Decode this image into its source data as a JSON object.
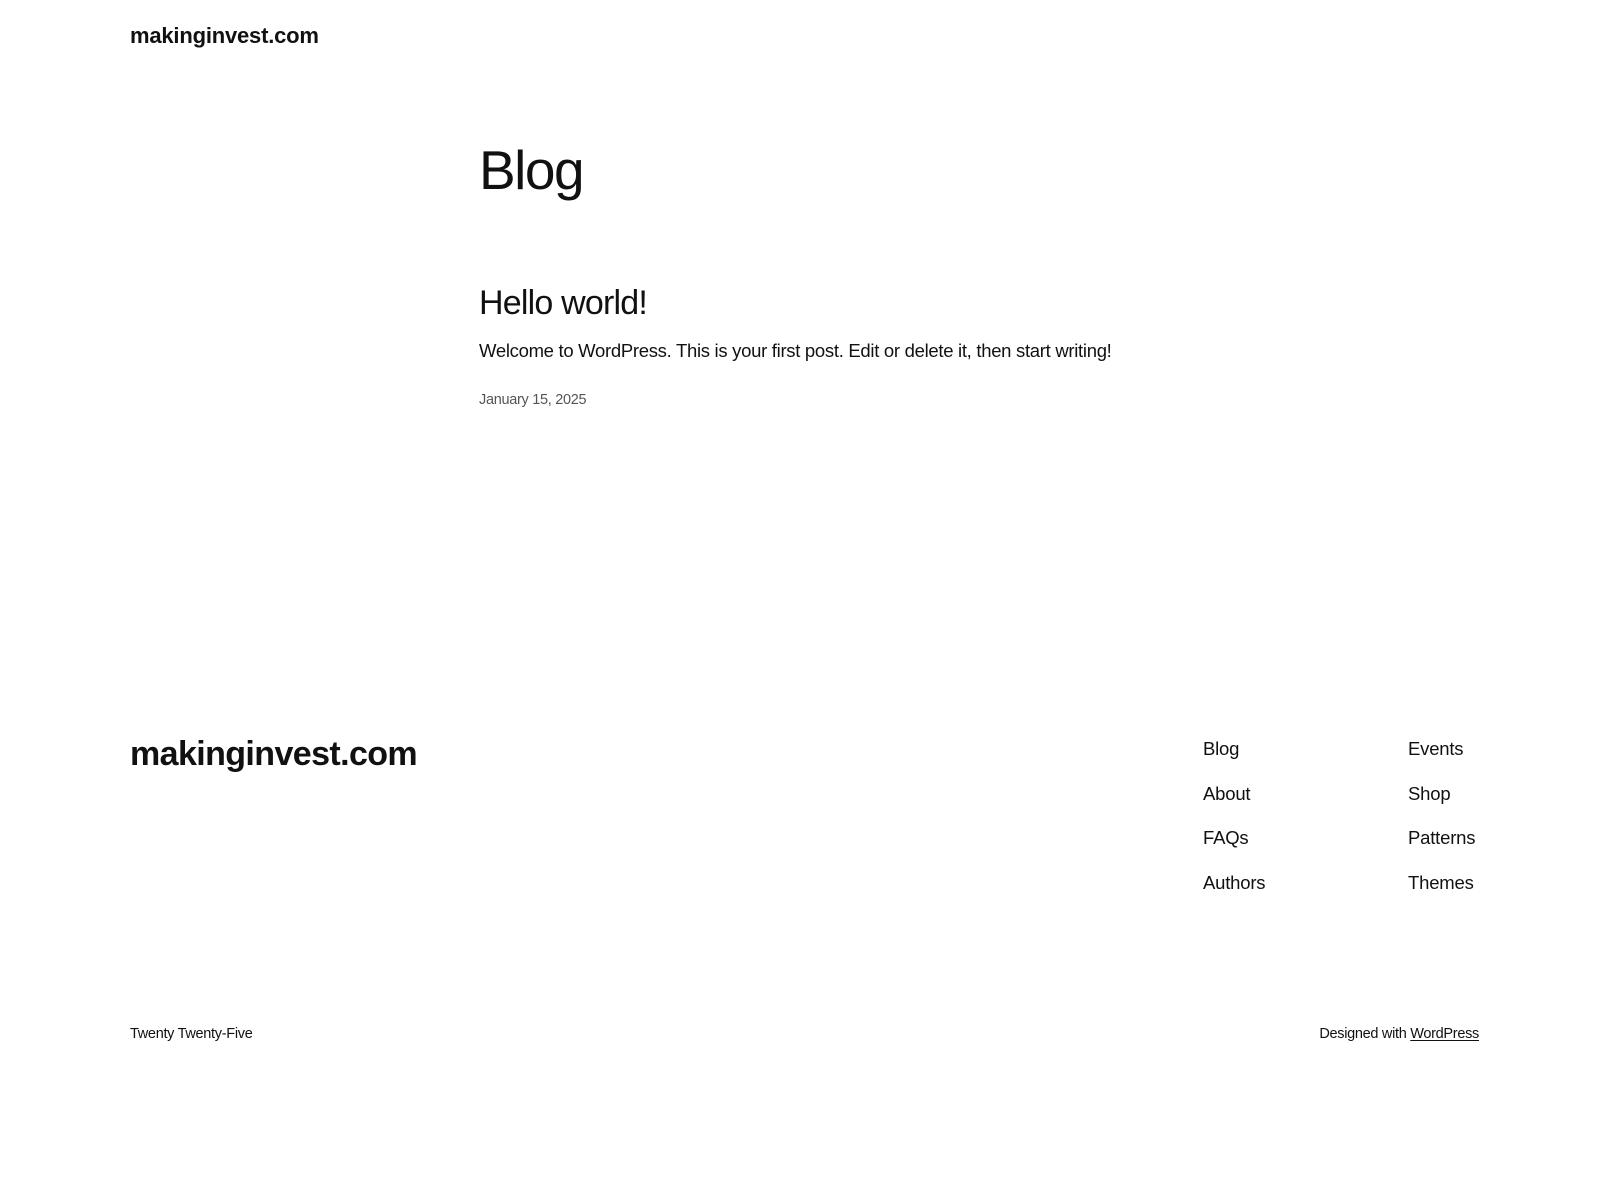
{
  "header": {
    "site_title": "makinginvest.com"
  },
  "main": {
    "page_title": "Blog",
    "posts": [
      {
        "title": "Hello world!",
        "excerpt": "Welcome to WordPress. This is your first post. Edit or delete it, then start writing!",
        "date": "January 15, 2025"
      }
    ]
  },
  "footer": {
    "site_title": "makinginvest.com",
    "nav_col1": [
      {
        "label": "Blog"
      },
      {
        "label": "About"
      },
      {
        "label": "FAQs"
      },
      {
        "label": "Authors"
      }
    ],
    "nav_col2": [
      {
        "label": "Events"
      },
      {
        "label": "Shop"
      },
      {
        "label": "Patterns"
      },
      {
        "label": "Themes"
      }
    ],
    "theme_name": "Twenty Twenty-Five",
    "credit_prefix": "Designed with ",
    "credit_link": "WordPress"
  }
}
